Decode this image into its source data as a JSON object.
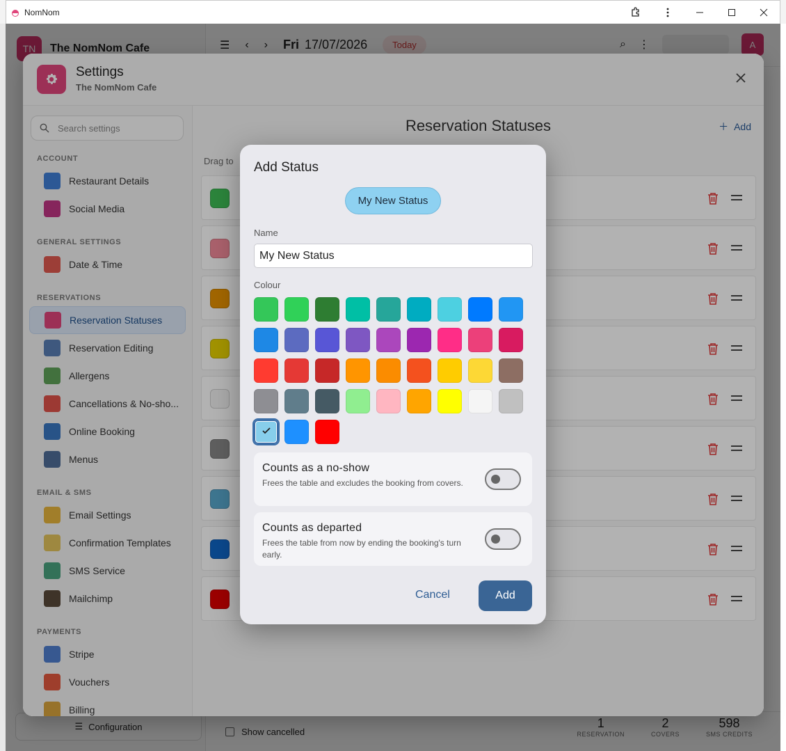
{
  "window": {
    "title": "NomNom"
  },
  "app": {
    "brand_initials": "TN",
    "brand_name": "The NomNom Cafe",
    "day": "Fri",
    "date": "17/07/2026",
    "today_label": "Today",
    "user_initial": "A",
    "configuration_label": "Configuration",
    "show_cancelled_label": "Show cancelled",
    "stats": [
      {
        "value": "1",
        "label": "RESERVATION"
      },
      {
        "value": "2",
        "label": "COVERS"
      },
      {
        "value": "598",
        "label": "SMS CREDITS"
      }
    ]
  },
  "settings": {
    "title": "Settings",
    "subtitle": "The NomNom Cafe",
    "search_placeholder": "Search settings",
    "sections": [
      {
        "title": "ACCOUNT",
        "items": [
          {
            "label": "Restaurant Details",
            "icon": "info-icon",
            "color": "#3f7fd6"
          },
          {
            "label": "Social Media",
            "icon": "instagram-icon",
            "color": "#c13584"
          }
        ]
      },
      {
        "title": "GENERAL SETTINGS",
        "items": [
          {
            "label": "Date & Time",
            "icon": "calendar-clock-icon",
            "color": "#e05a4f"
          }
        ]
      },
      {
        "title": "RESERVATIONS",
        "items": [
          {
            "label": "Reservation Statuses",
            "icon": "status-list-icon",
            "color": "#e0457b",
            "active": true
          },
          {
            "label": "Reservation Editing",
            "icon": "edit-document-icon",
            "color": "#5a7fb5"
          },
          {
            "label": "Allergens",
            "icon": "allergen-icon",
            "color": "#5fa35a"
          },
          {
            "label": "Cancellations & No-sho...",
            "icon": "cancel-icon",
            "color": "#e0524a"
          },
          {
            "label": "Online Booking",
            "icon": "globe-icon",
            "color": "#3a78c2"
          },
          {
            "label": "Menus",
            "icon": "menu-book-icon",
            "color": "#4f6e99"
          }
        ]
      },
      {
        "title": "EMAIL & SMS",
        "items": [
          {
            "label": "Email Settings",
            "icon": "envelope-icon",
            "color": "#e7b53d"
          },
          {
            "label": "Confirmation Templates",
            "icon": "template-icon",
            "color": "#e3c35c"
          },
          {
            "label": "SMS Service",
            "icon": "sms-icon",
            "color": "#4aa37f"
          },
          {
            "label": "Mailchimp",
            "icon": "mailchimp-icon",
            "color": "#5a4a3a"
          }
        ]
      },
      {
        "title": "PAYMENTS",
        "items": [
          {
            "label": "Stripe",
            "icon": "stripe-icon",
            "color": "#4f7fcf"
          },
          {
            "label": "Vouchers",
            "icon": "voucher-icon",
            "color": "#e35a3f"
          },
          {
            "label": "Billing",
            "icon": "billing-icon",
            "color": "#d9a43d"
          }
        ]
      }
    ],
    "main": {
      "title": "Reservation Statuses",
      "add_label": "Add",
      "hint": "Drag to",
      "status_colors": [
        "#3fbf57",
        "#f48c9b",
        "#e89300",
        "#e8d300",
        "#f4f4f4",
        "#888888",
        "#5aa9cf",
        "#1167c9",
        "#e00000"
      ]
    }
  },
  "dialog": {
    "title": "Add Status",
    "preview_label": "My New Status",
    "name_label": "Name",
    "name_value": "My New Status",
    "colour_label": "Colour",
    "palette": [
      [
        "#34c759",
        "#30d158",
        "#2e7d32",
        "#00bfa5",
        "#26a69a",
        "#00acc1",
        "#4dd0e1",
        "#007aff",
        "#2196f3"
      ],
      [
        "#1e88e5",
        "#5c6bc0",
        "#5856d6",
        "#7e57c2",
        "#ab47bc",
        "#9c27b0",
        "#ff2d87",
        "#ec407a",
        "#d81b60"
      ],
      [
        "#ff3b30",
        "#e53935",
        "#c62828",
        "#ff9500",
        "#fb8c00",
        "#f4511e",
        "#ffcc00",
        "#fdd835",
        "#8d6e63"
      ],
      [
        "#8e8e93",
        "#607d8b",
        "#455a64",
        "#90ee90",
        "#ffb6c1",
        "#ffa500",
        "#ffff00",
        "#f5f5f5",
        "#c0c0c0"
      ],
      [
        "#87ceeb",
        "#1e90ff",
        "#ff0000"
      ]
    ],
    "selected_colour": "#87ceeb",
    "toggles": [
      {
        "title": "Counts as a no-show",
        "description": "Frees the table and excludes the booking from covers.",
        "on": false
      },
      {
        "title": "Counts as departed",
        "description": "Frees the table from now by ending the booking's turn early.",
        "on": false
      }
    ],
    "cancel_label": "Cancel",
    "add_label": "Add"
  }
}
